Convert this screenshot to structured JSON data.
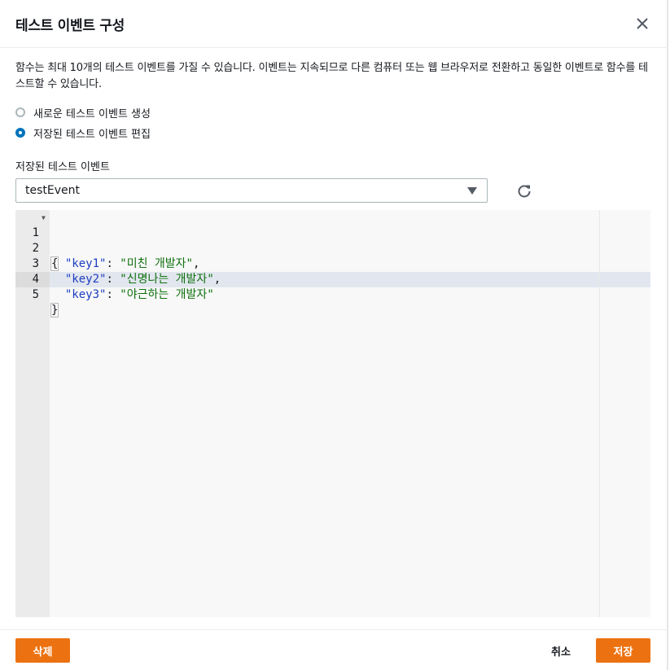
{
  "dialog": {
    "title": "테스트 이벤트 구성",
    "description": "함수는 최대 10개의 테스트 이벤트를 가질 수 있습니다. 이벤트는 지속되므로 다른 컴퓨터 또는 웹 브라우저로 전환하고 동일한 이벤트로 함수를 테스트할 수 있습니다."
  },
  "options": [
    {
      "label": "새로운 테스트 이벤트 생성",
      "checked": false
    },
    {
      "label": "저장된 테스트 이벤트 편집",
      "checked": true
    }
  ],
  "saved_events": {
    "label": "저장된 테스트 이벤트",
    "selected": "testEvent"
  },
  "editor": {
    "lines": [
      {
        "num": "1",
        "open": "{"
      },
      {
        "num": "2",
        "key": "\"key1\"",
        "value": "\"미친 개발자\"",
        "comma": ","
      },
      {
        "num": "3",
        "key": "\"key2\"",
        "value": "\"신명나는 개발자\"",
        "comma": ","
      },
      {
        "num": "4",
        "key": "\"key3\"",
        "value": "\"야근하는 개발자\"",
        "comma": ""
      },
      {
        "num": "5",
        "close": "}"
      }
    ]
  },
  "footer": {
    "delete_label": "삭제",
    "cancel_label": "취소",
    "save_label": "저장"
  },
  "colors": {
    "accent": "#ec7211",
    "radio_selected": "#0073bb",
    "json_key": "#1d3ec1",
    "json_string": "#10710f"
  },
  "icons": [
    "close-icon",
    "caret-down-icon",
    "refresh-icon",
    "fold-arrow-icon"
  ]
}
